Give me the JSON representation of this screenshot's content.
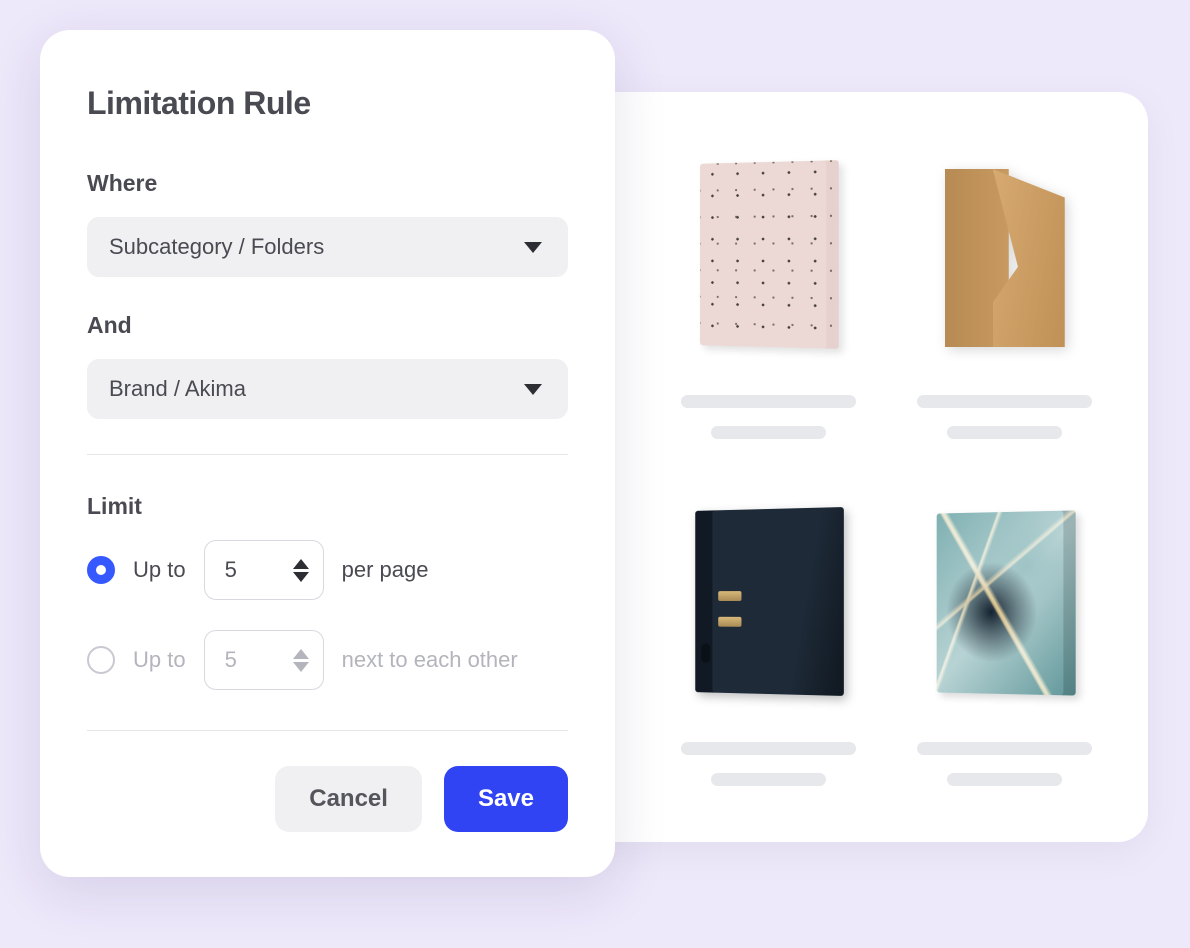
{
  "modal": {
    "title": "Limitation Rule",
    "where_label": "Where",
    "where_value": "Subcategory / Folders",
    "and_label": "And",
    "and_value": "Brand / Akima",
    "limit_label": "Limit",
    "options": [
      {
        "prefix": "Up to",
        "value": "5",
        "suffix": "per page",
        "selected": true
      },
      {
        "prefix": "Up to",
        "value": "5",
        "suffix": "next to each other",
        "selected": false
      }
    ],
    "cancel": "Cancel",
    "save": "Save"
  },
  "colors": {
    "accent": "#3144f3",
    "radio": "#3658ff"
  }
}
